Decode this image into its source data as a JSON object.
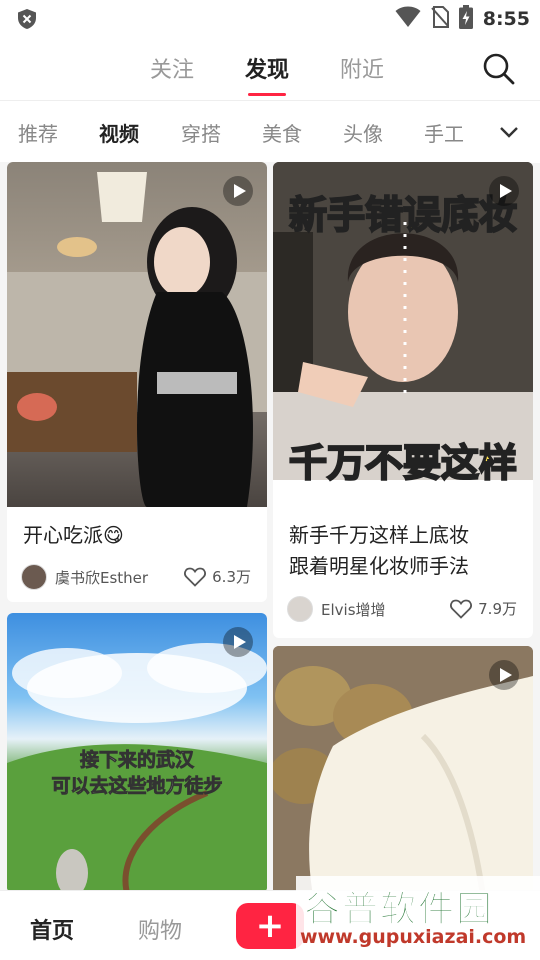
{
  "status_bar": {
    "time": "8:55",
    "icons": [
      "shield-icon",
      "wifi-icon",
      "no-sim-icon",
      "battery-charging-icon"
    ]
  },
  "top_nav": {
    "tabs": [
      {
        "label": "关注",
        "active": false
      },
      {
        "label": "发现",
        "active": true
      },
      {
        "label": "附近",
        "active": false
      }
    ],
    "accent_color": "#ff2442",
    "search_icon": "search-icon"
  },
  "categories": {
    "items": [
      {
        "label": "推荐",
        "active": false
      },
      {
        "label": "视频",
        "active": true
      },
      {
        "label": "穿搭",
        "active": false
      },
      {
        "label": "美食",
        "active": false
      },
      {
        "label": "头像",
        "active": false
      },
      {
        "label": "手工",
        "active": false
      }
    ],
    "more_icon": "chevron-down-icon"
  },
  "feed": {
    "cards": [
      {
        "title": "开心吃派😋",
        "author": "虞书欣Esther",
        "likes": "6.3万",
        "is_video": true
      },
      {
        "title_line1": "新手千万这样上底妆",
        "title_line2": "跟着明星化妆师手法",
        "author": "Elvis增增",
        "likes": "7.9万",
        "is_video": true,
        "overlay_top": "新手错误底妆",
        "overlay_bottom": "千万不要这样"
      },
      {
        "is_video": true,
        "overlay_line1": "接下来的武汉",
        "overlay_line2": "可以去这些地方徒步"
      },
      {
        "is_video": true
      }
    ]
  },
  "bottom_nav": {
    "items": [
      {
        "label": "首页",
        "active": true
      },
      {
        "label": "购物",
        "active": false
      }
    ],
    "plus_label": "+"
  },
  "watermark": {
    "title": "谷普软件园",
    "url": "www.gupuxiazai.com"
  }
}
